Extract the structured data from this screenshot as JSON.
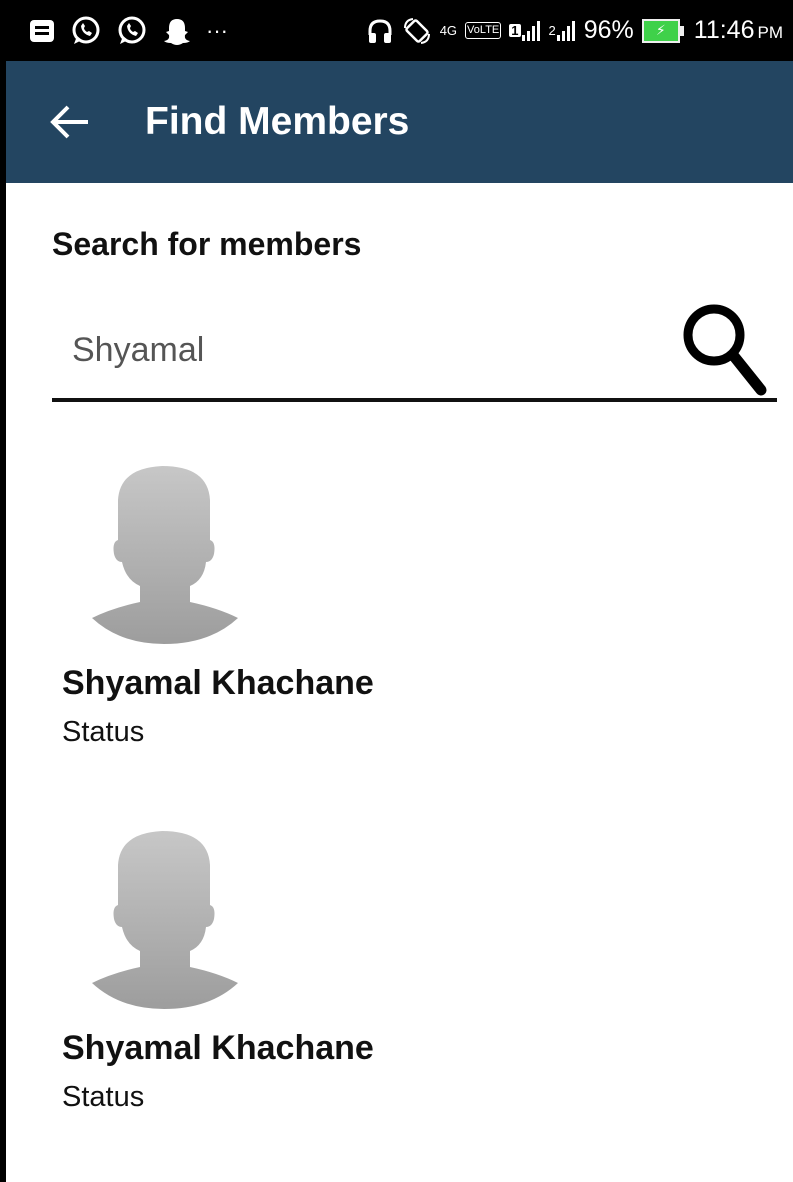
{
  "status_bar": {
    "network": "4G",
    "volte": "VoLTE",
    "sim1": "1",
    "sim2": "2",
    "battery": "96%",
    "time": "11:46",
    "ampm": "PM"
  },
  "app_bar": {
    "title": "Find Members"
  },
  "search": {
    "heading": "Search for members",
    "value": "Shyamal",
    "placeholder": ""
  },
  "members": [
    {
      "name": "Shyamal Khachane",
      "status": "Status"
    },
    {
      "name": "Shyamal Khachane",
      "status": "Status"
    }
  ],
  "colors": {
    "app_bar": "#234561",
    "status_bar": "#000000",
    "avatar": "#bdbdbd",
    "battery": "#3fd14a"
  },
  "icons": [
    "notification-icon",
    "whatsapp-icon",
    "whatsapp-icon",
    "snapchat-icon",
    "more-icon",
    "headphones-icon",
    "rotate-icon",
    "signal-icon",
    "battery-icon",
    "back-arrow-icon",
    "search-icon",
    "avatar-icon"
  ]
}
